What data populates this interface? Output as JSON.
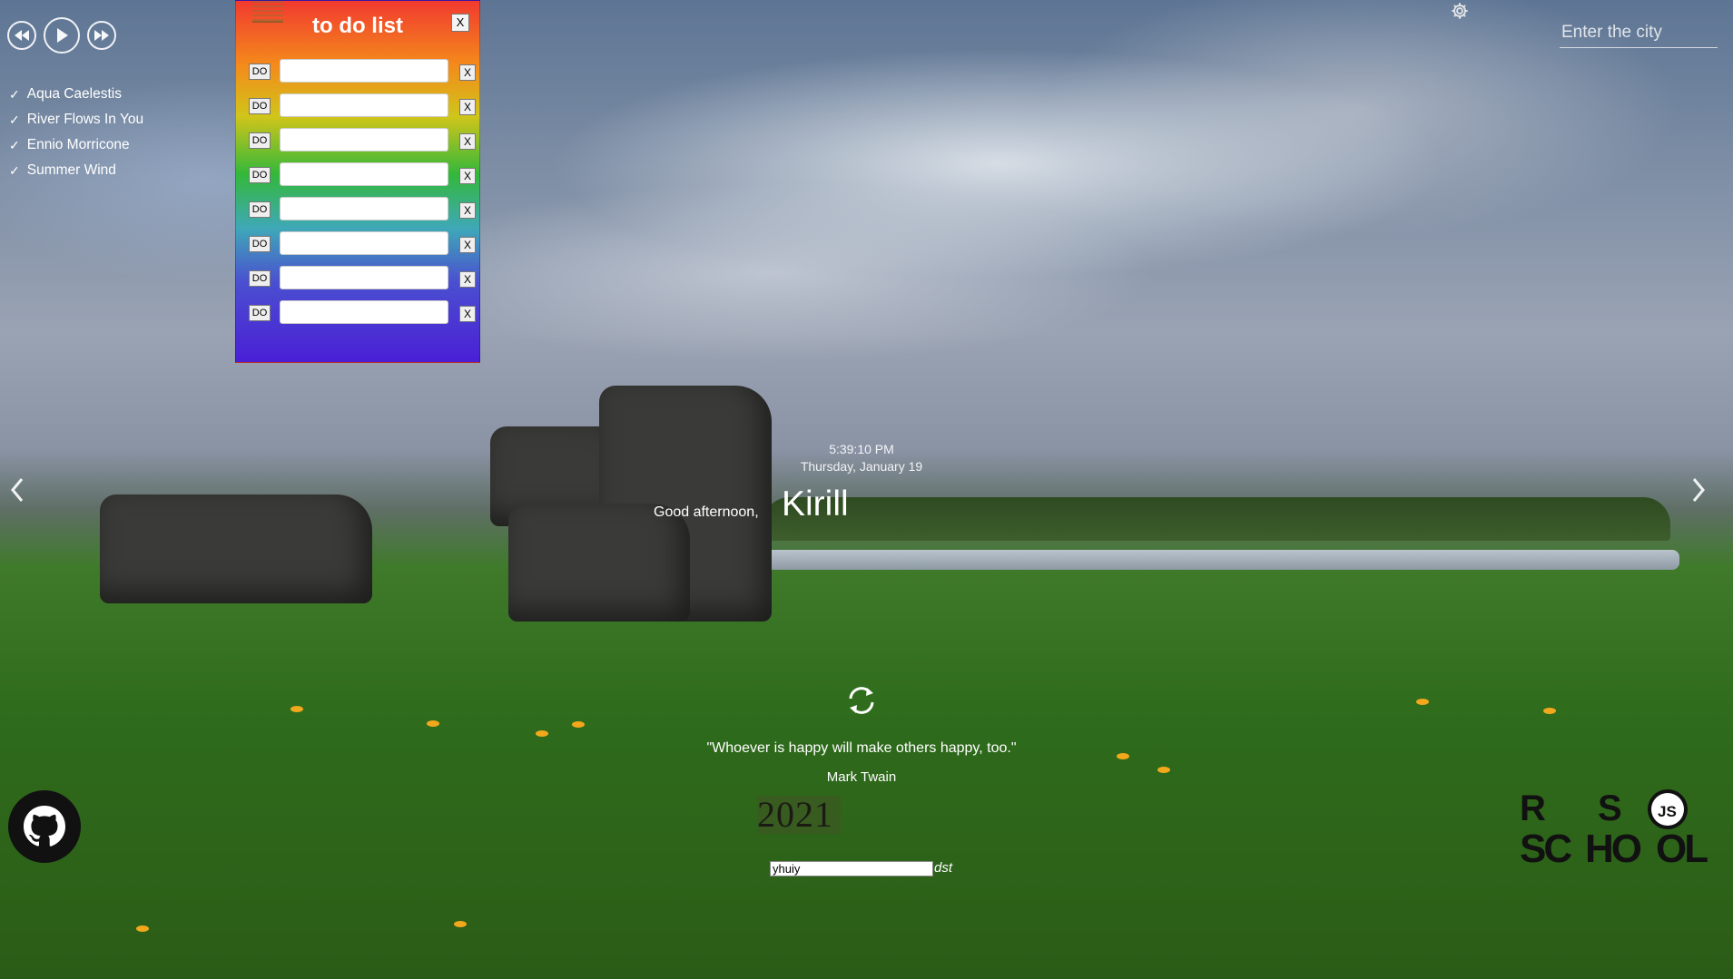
{
  "player": {
    "prev_icon": "rewind-icon",
    "play_icon": "play-icon",
    "next_icon": "fast-forward-icon",
    "playlist": [
      {
        "label": "Aqua Caelestis"
      },
      {
        "label": "River Flows In You"
      },
      {
        "label": "Ennio Morricone"
      },
      {
        "label": "Summer Wind"
      }
    ],
    "check_glyph": "✓"
  },
  "todo": {
    "title": "to do list",
    "close_label": "X",
    "do_label": "DO",
    "delete_label": "X",
    "rows": [
      "",
      "",
      "",
      "",
      "",
      "",
      "",
      ""
    ]
  },
  "header": {
    "city_placeholder": "Enter the city",
    "settings_icon": "gear-icon"
  },
  "clock": {
    "time": "5:39:10 PM",
    "date": "Thursday, January 19"
  },
  "greeting": {
    "text": "Good afternoon,",
    "name": "Kirill"
  },
  "quote": {
    "text": "\"Whoever is happy will make others happy, too.\"",
    "author": "Mark Twain"
  },
  "footer": {
    "year": "2021",
    "input_value": "yhuiy",
    "dst_label": "dst",
    "github_icon": "github-icon",
    "logo_text": "RS SCHOOL JS"
  }
}
